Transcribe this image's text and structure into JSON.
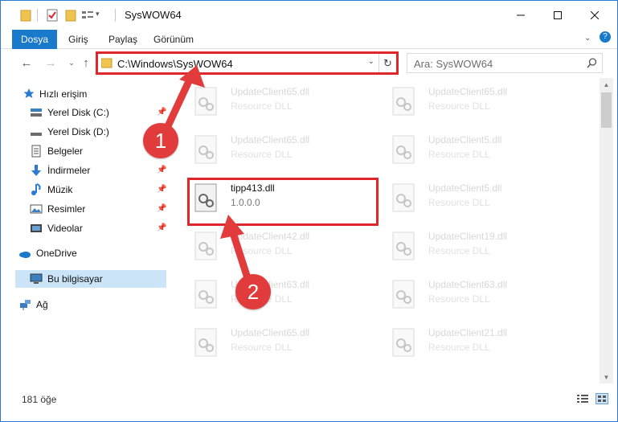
{
  "window": {
    "title": "SysWOW64"
  },
  "ribbon": {
    "tabs": [
      "Dosya",
      "Giriş",
      "Paylaş",
      "Görünüm"
    ]
  },
  "address": {
    "path": "C:\\Windows\\SysWOW64"
  },
  "search": {
    "placeholder": "Ara: SysWOW64"
  },
  "sidebar": {
    "quick_access": "Hızlı erişim",
    "items": [
      {
        "label": "Yerel Disk (C:)",
        "pinned": true
      },
      {
        "label": "Yerel Disk (D:)",
        "pinned": false
      },
      {
        "label": "Belgeler",
        "pinned": false
      },
      {
        "label": "İndirmeler",
        "pinned": true
      },
      {
        "label": "Müzik",
        "pinned": true
      },
      {
        "label": "Resimler",
        "pinned": true
      },
      {
        "label": "Videolar",
        "pinned": true
      }
    ],
    "onedrive": "OneDrive",
    "this_pc": "Bu bilgisayar",
    "network": "Ağ"
  },
  "files": [
    {
      "name": "UpdateClient65.dll",
      "desc": "Resource DLL"
    },
    {
      "name": "UpdateClient65.dll",
      "desc": "Resource DLL"
    },
    {
      "name": "UpdateClient65.dll",
      "desc": "Resource DLL"
    },
    {
      "name": "UpdateClient5.dll",
      "desc": "Resource DLL"
    },
    {
      "name": "tipp413.dll",
      "desc": "1.0.0.0"
    },
    {
      "name": "UpdateClient5.dll",
      "desc": "Resource DLL"
    },
    {
      "name": "UpdateClient42.dll",
      "desc": "Resource DLL"
    },
    {
      "name": "UpdateClient19.dll",
      "desc": "Resource DLL"
    },
    {
      "name": "UpdateClient63.dll",
      "desc": "Resource DLL"
    },
    {
      "name": "UpdateClient63.dll",
      "desc": "Resource DLL"
    },
    {
      "name": "UpdateClient65.dll",
      "desc": "Resource DLL"
    },
    {
      "name": "UpdateClient21.dll",
      "desc": "Resource DLL"
    }
  ],
  "status": {
    "count": "181 öğe"
  },
  "callouts": [
    "1",
    "2"
  ],
  "colors": {
    "accent": "#1979ca",
    "highlight": "#e0262b",
    "callout": "#e23b3b",
    "selection": "#cce4f7"
  }
}
